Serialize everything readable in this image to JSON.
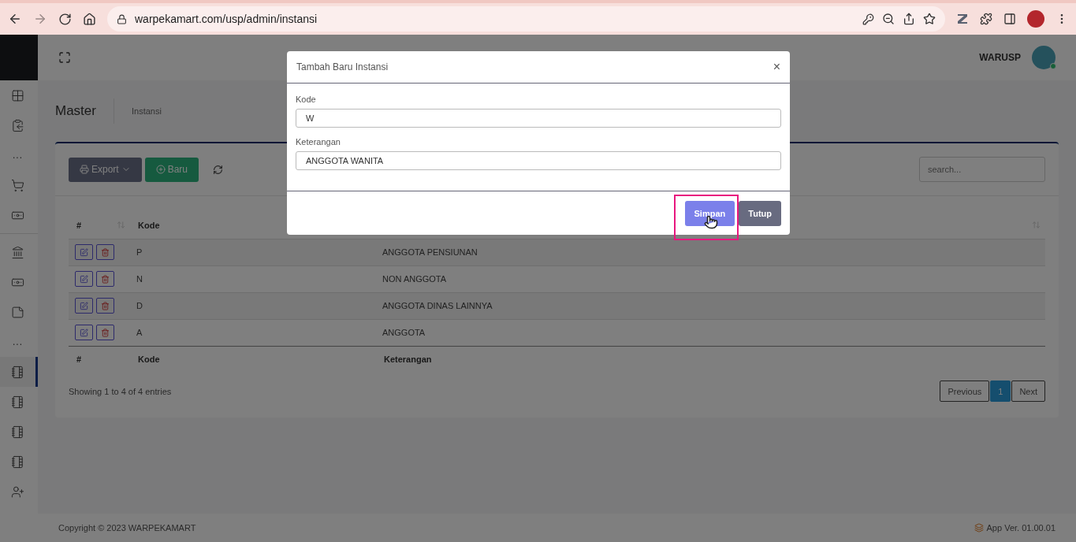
{
  "browser": {
    "url": "warpekamart.com/usp/admin/instansi"
  },
  "header": {
    "user": "WARUSP"
  },
  "sidebar": {
    "items": [
      {
        "kind": "icon",
        "selected": false
      },
      {
        "kind": "icon",
        "selected": false
      },
      {
        "kind": "more",
        "label": "..."
      },
      {
        "kind": "icon",
        "selected": false
      },
      {
        "kind": "icon",
        "selected": false
      },
      {
        "kind": "divider"
      },
      {
        "kind": "icon",
        "selected": false
      },
      {
        "kind": "icon",
        "selected": false
      },
      {
        "kind": "icon",
        "selected": false
      },
      {
        "kind": "more",
        "label": "..."
      },
      {
        "kind": "icon",
        "selected": true
      },
      {
        "kind": "icon",
        "selected": false
      },
      {
        "kind": "icon",
        "selected": false
      },
      {
        "kind": "icon",
        "selected": false
      },
      {
        "kind": "icon",
        "selected": false
      }
    ]
  },
  "breadcrumb": {
    "title": "Master",
    "current": "Instansi"
  },
  "toolbar": {
    "export": "Export",
    "new": "Baru",
    "search_placeholder": "search..."
  },
  "table": {
    "header": [
      "#",
      "Kode"
    ],
    "rows": [
      {
        "kode": "P",
        "keterangan": "ANGGOTA PENSIUNAN"
      },
      {
        "kode": "N",
        "keterangan": "NON ANGGOTA"
      },
      {
        "kode": "D",
        "keterangan": "ANGGOTA DINAS LAINNYA"
      },
      {
        "kode": "A",
        "keterangan": "ANGGOTA"
      }
    ],
    "footer": [
      "#",
      "Kode",
      "Keterangan"
    ],
    "info": "Showing 1 to 4 of 4 entries",
    "pagination": [
      {
        "label": "Previous",
        "selected": false
      },
      {
        "label": "1",
        "selected": true
      },
      {
        "label": "Next",
        "selected": false
      }
    ]
  },
  "footer": {
    "copyright": "Copyright © 2023 WARPEKAMART",
    "version": "App Ver. 01.00.01"
  },
  "modal": {
    "title": "Tambah Baru Instansi",
    "close": "×",
    "fields": [
      {
        "label": "Kode",
        "value": "W"
      },
      {
        "label": "Keterangan",
        "value": "ANGGOTA WANITA"
      }
    ],
    "buttons": [
      {
        "label": "Simpan",
        "kind": "primary",
        "highlighted": true
      },
      {
        "label": "Tutup",
        "kind": "secondary",
        "highlighted": false
      }
    ]
  }
}
